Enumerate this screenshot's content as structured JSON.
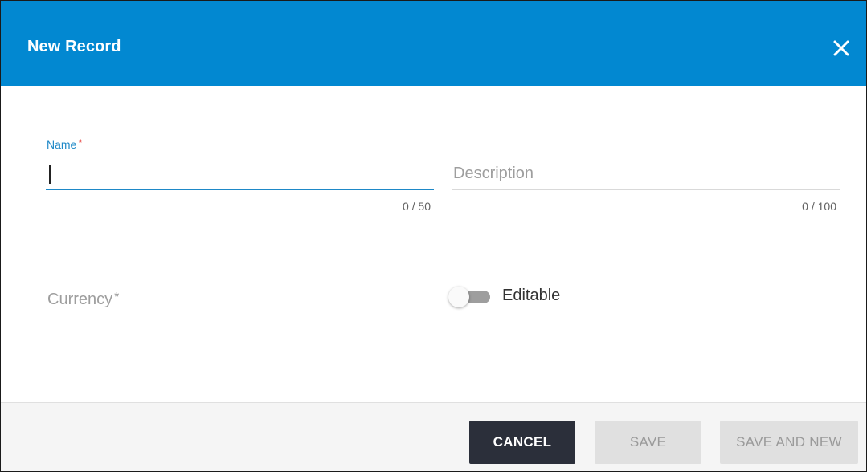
{
  "dialog": {
    "title": "New Record",
    "close_icon": "close-icon",
    "header_color": "#0288d1"
  },
  "form": {
    "name": {
      "label": "Name",
      "required_mark": "*",
      "value": "",
      "counter": "0 / 50"
    },
    "description": {
      "placeholder": "Description",
      "value": "",
      "counter": "0 / 100"
    },
    "currency": {
      "placeholder": "Currency",
      "required_mark": "*",
      "value": ""
    },
    "editable": {
      "label": "Editable",
      "checked": false
    }
  },
  "footer": {
    "cancel_label": "CANCEL",
    "save_label": "SAVE",
    "save_and_new_label": "SAVE AND NEW"
  }
}
